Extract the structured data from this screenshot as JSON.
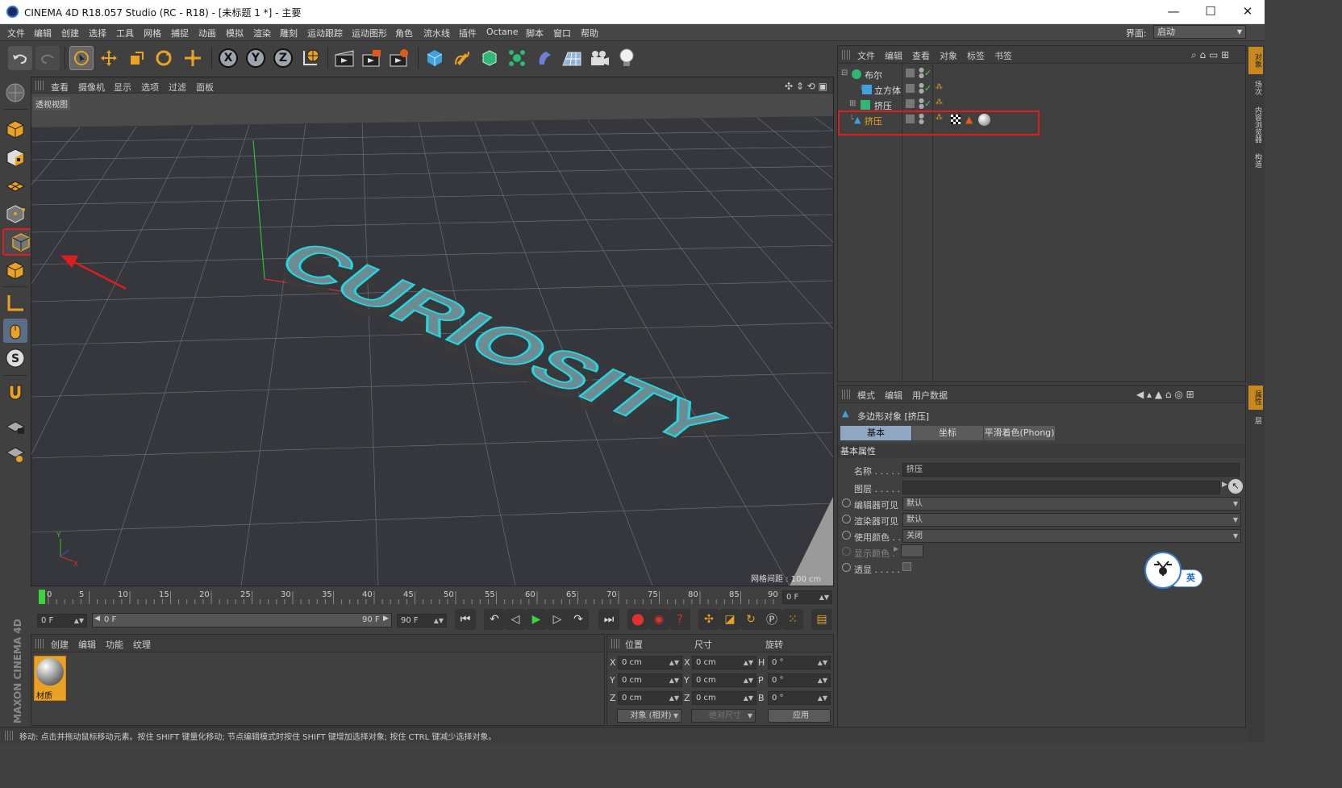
{
  "window": {
    "title": "CINEMA 4D R18.057 Studio (RC - R18) - [未标题 1 *] - 主要",
    "minimize": "—",
    "maximize": "☐",
    "close": "✕"
  },
  "menu": [
    "文件",
    "编辑",
    "创建",
    "选择",
    "工具",
    "网格",
    "捕捉",
    "动画",
    "模拟",
    "渲染",
    "雕刻",
    "运动跟踪",
    "运动图形",
    "角色",
    "流水线",
    "插件",
    "Octane",
    "脚本",
    "窗口",
    "帮助"
  ],
  "layout": {
    "label": "界面:",
    "value": "启动"
  },
  "viewport": {
    "menu": [
      "查看",
      "摄像机",
      "显示",
      "选项",
      "过滤",
      "面板"
    ],
    "label": "透视视图",
    "grid_spacing": "网格间距 : 100 cm",
    "text3d": "CURIOSITY"
  },
  "objects_panel": {
    "menu": [
      "文件",
      "编辑",
      "查看",
      "对象",
      "标签",
      "书签"
    ],
    "items": [
      "布尔",
      "立方体",
      "挤压",
      "挤压"
    ]
  },
  "right_tabs": {
    "top": [
      "对象",
      "场次",
      "内容浏览器",
      "构造"
    ],
    "bottom": [
      "属性",
      "层"
    ]
  },
  "attr_panel": {
    "menu": [
      "模式",
      "编辑",
      "用户数据"
    ],
    "object_title": "多边形对象 [挤压]",
    "tabs": [
      "基本",
      "坐标",
      "平滑着色(Phong)"
    ],
    "section": "基本属性",
    "rows": [
      {
        "label": "名称 . . . . .",
        "value": "挤压"
      },
      {
        "label": "图层 . . . . .",
        "value": ""
      },
      {
        "label": "编辑器可见",
        "value": "默认"
      },
      {
        "label": "渲染器可见",
        "value": "默认"
      },
      {
        "label": "使用颜色 . .",
        "value": "关闭"
      },
      {
        "label": "显示颜色 . ",
        "value": ""
      },
      {
        "label": "透显 . . . . .",
        "value": ""
      }
    ],
    "badge": "英"
  },
  "timeline": {
    "ticks": [
      "0",
      "5",
      "10",
      "15",
      "20",
      "25",
      "30",
      "35",
      "40",
      "45",
      "50",
      "55",
      "60",
      "65",
      "70",
      "75",
      "80",
      "85",
      "90"
    ],
    "current": "0 F"
  },
  "transport": {
    "start": "0 F",
    "range_start": "0 F",
    "range_end": "90 F",
    "end": "90 F"
  },
  "materials": {
    "menu": [
      "创建",
      "编辑",
      "功能",
      "纹理"
    ],
    "item": "材质"
  },
  "coords": {
    "headers": [
      "位置",
      "尺寸",
      "旋转"
    ],
    "rows": [
      {
        "axis": "X",
        "pos": "0 cm",
        "size_axis": "X",
        "size": "0 cm",
        "rot_axis": "H",
        "rot": "0 °"
      },
      {
        "axis": "Y",
        "pos": "0 cm",
        "size_axis": "Y",
        "size": "0 cm",
        "rot_axis": "P",
        "rot": "0 °"
      },
      {
        "axis": "Z",
        "pos": "0 cm",
        "size_axis": "Z",
        "size": "0 cm",
        "rot_axis": "B",
        "rot": "0 °"
      }
    ],
    "mode": "对象 (相对)",
    "size_mode": "绝对尺寸",
    "apply": "应用"
  },
  "status": "移动: 点击并拖动鼠标移动元素。按住 SHIFT 键量化移动; 节点编辑模式时按住 SHIFT 键增加选择对象; 按住 CTRL 键减少选择对象。",
  "brand": "MAXON CINEMA 4D",
  "colors": {
    "accent_orange": "#f0a020",
    "highlight_red": "#e01d1d",
    "text3d_cyan": "#27d5df",
    "tab_active": "#8fa7c2"
  }
}
